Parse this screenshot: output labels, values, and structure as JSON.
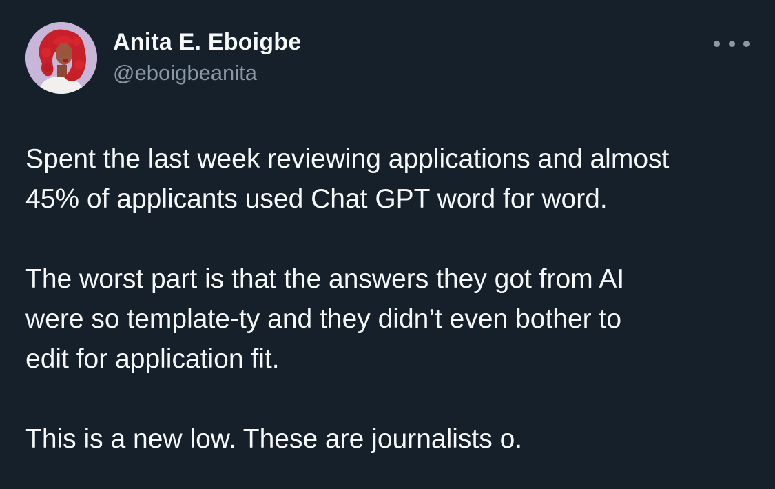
{
  "author": {
    "name": "Anita E. Eboigbe",
    "handle": "@eboigbeanita",
    "avatar_icon": "profile-avatar-illustration"
  },
  "menu": {
    "icon": "more-options-icon"
  },
  "tweet": {
    "paragraphs": [
      {
        "lines": [
          "Spent the last week reviewing applications and almost",
          "45% of applicants used Chat GPT word for word."
        ]
      },
      {
        "lines": [
          "The worst part is that the answers they got from AI",
          "were so template-ty and they didn’t even bother to",
          "edit for application fit."
        ]
      },
      {
        "lines": [
          "This is a new low. These are journalists o."
        ]
      }
    ]
  },
  "colors": {
    "background": "#15202b",
    "primary_text": "#f7f9f9",
    "secondary_text": "#8b98a5"
  }
}
